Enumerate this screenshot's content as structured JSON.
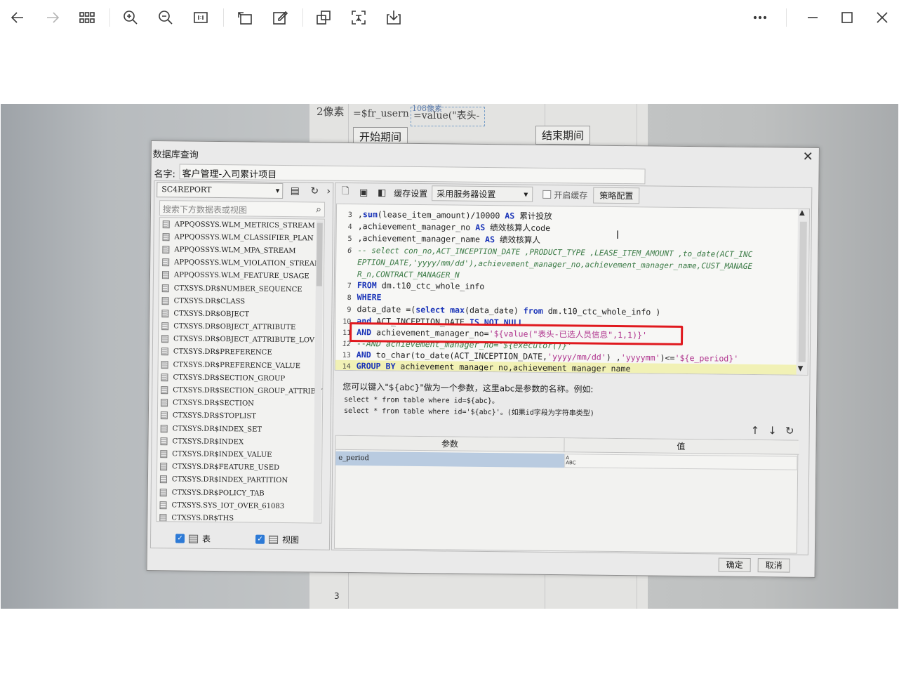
{
  "viewer": {
    "toolbar": {
      "back_icon": "arrow-left-icon",
      "forward_icon": "arrow-right-icon",
      "grid_icon": "grid-icon",
      "zoom_in_icon": "zoom-in-icon",
      "zoom_out_icon": "zoom-out-icon",
      "actual_size_icon": "actual-size-icon",
      "rotate_icon": "rotate-icon",
      "edit_icon": "edit-icon",
      "crop_icon": "crop-icon",
      "ocr_icon": "text-recognition-icon",
      "save_icon": "save-icon",
      "more_icon": "more-icon",
      "minimize_icon": "minimize-icon",
      "maximize_icon": "maximize-icon",
      "close_icon": "close-icon"
    }
  },
  "photo": {
    "sheet": {
      "label_pixels": "2像素",
      "formula_user": "=$fr_usern",
      "formula_value": "=value(\"表头-",
      "top_text": "108像素",
      "start_period": "开始期间",
      "end_period": "结束期间",
      "row_number": "3"
    },
    "dialog": {
      "title": "数据库查询",
      "name_label": "名字:",
      "name_value": "客户管理-入司累计项目",
      "database": "SC4REPORT",
      "search_placeholder": "搜索下方数据表或视图",
      "tables": [
        "APPQOSSYS.WLM_METRICS_STREAM",
        "APPQOSSYS.WLM_CLASSIFIER_PLAN",
        "APPQOSSYS.WLM_MPA_STREAM",
        "APPQOSSYS.WLM_VIOLATION_STREAM",
        "APPQOSSYS.WLM_FEATURE_USAGE",
        "CTXSYS.DR$NUMBER_SEQUENCE",
        "CTXSYS.DR$CLASS",
        "CTXSYS.DR$OBJECT",
        "CTXSYS.DR$OBJECT_ATTRIBUTE",
        "CTXSYS.DR$OBJECT_ATTRIBUTE_LOV",
        "CTXSYS.DR$PREFERENCE",
        "CTXSYS.DR$PREFERENCE_VALUE",
        "CTXSYS.DR$SECTION_GROUP",
        "CTXSYS.DR$SECTION_GROUP_ATTRIBUTE",
        "CTXSYS.DR$SECTION",
        "CTXSYS.DR$STOPLIST",
        "CTXSYS.DR$INDEX_SET",
        "CTXSYS.DR$INDEX",
        "CTXSYS.DR$INDEX_VALUE",
        "CTXSYS.DR$FEATURE_USED",
        "CTXSYS.DR$INDEX_PARTITION",
        "CTXSYS.DR$POLICY_TAB",
        "CTXSYS.SYS_IOT_OVER_61083",
        "CTXSYS.DR$THS"
      ],
      "filter_table": "表",
      "filter_view": "视图",
      "cache_settings": "缓存设置",
      "server_settings": "采用服务器设置",
      "enable_cache": "开启缓存",
      "policy": "策略配置",
      "code": {
        "l3_num": "3",
        "l3_a": ",",
        "l3_kw": "sum",
        "l3_b": "(lease_item_amount)/10000 ",
        "l3_kw2": "AS",
        "l3_c": " 累计投放",
        "l4_num": "4",
        "l4_a": ",achievement_manager_no ",
        "l4_kw": "AS",
        "l4_b": " 绩效核算人code",
        "l5_num": "5",
        "l5_a": ",achievement_manager_name ",
        "l5_kw": "AS",
        "l5_b": " 绩效核算人",
        "l6_num": "6",
        "l6_a": "-- select con_no,ACT_INCEPTION_DATE ,PRODUCT_TYPE ,LEASE_ITEM_AMOUNT ,to_date(ACT_INC",
        "l6_b": "EPTION_DATE,'yyyy/mm/dd'),achievement_manager_no,achievement_manager_name,CUST_MANAGE",
        "l6_c": "R_n,CONTRACT_MANAGER_N",
        "l7_num": "7",
        "l7_kw": "FROM",
        "l7_a": " dm.t10_ctc_whole_info",
        "l8_num": "8",
        "l8_kw": "WHERE",
        "l9_num": "9",
        "l9_a": "data_date =(",
        "l9_kw": "select max",
        "l9_b": "(data_date) ",
        "l9_kw2": "from",
        "l9_c": " dm.t10_ctc_whole_info )",
        "l10_num": "10",
        "l10_kw": "and",
        "l10_a": " ACT_INCEPTION_DATE ",
        "l10_kw2": "IS NOT NULL",
        "l11_num": "11",
        "l11_kw": "AND",
        "l11_a": " achievement_manager_no=",
        "l11_str": "'${value(\"表头-已选人员信息\",1,1)}'",
        "l12_num": "12",
        "l12_a": "--AND achievement_manager_no='${executor()}'",
        "l13_num": "13",
        "l13_kw": "AND",
        "l13_a": " to_char(to_date(ACT_INCEPTION_DATE,",
        "l13_str": "'yyyy/mm/dd'",
        "l13_b": ") ,",
        "l13_str2": "'yyyymm'",
        "l13_c": ")<=",
        "l13_str3": "'${e_period}'",
        "l14_num": "14",
        "l14_kw": "GROUP BY",
        "l14_a": " achievement_manager_no,achievement_manager_name"
      },
      "hint_line1": "您可以键入\"${abc}\"做为一个参数，这里abc是参数的名称。例如:",
      "hint_line2": "select * from table where id=${abc}。",
      "hint_line3": "select * from table where id='${abc}'。(如果id字段为字符串类型)",
      "param_header_name": "参数",
      "param_header_value": "值",
      "params": [
        {
          "name": "e_period",
          "value": ""
        }
      ],
      "ok_label": "确定",
      "cancel_label": "取消"
    }
  }
}
